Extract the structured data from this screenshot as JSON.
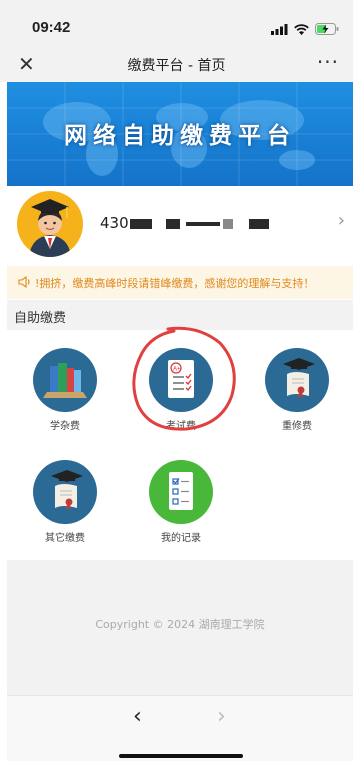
{
  "status_bar": {
    "time": "09:42"
  },
  "nav": {
    "title": "缴费平台 - 首页",
    "close_glyph": "✕",
    "more_glyph": "···"
  },
  "banner": {
    "text": "网络自助缴费平台"
  },
  "user": {
    "id_prefix": "430"
  },
  "notice": {
    "text": "!拥挤，缴费高峰时段请错峰缴费，感谢您的理解与支持！"
  },
  "section": {
    "title": "自助缴费"
  },
  "tiles": [
    {
      "label": "学杂费",
      "icon": "books-icon",
      "color": "#2b6a95"
    },
    {
      "label": "考试费",
      "icon": "exam-paper-icon",
      "color": "#2b6a95"
    },
    {
      "label": "重修费",
      "icon": "diploma-icon",
      "color": "#2b6a95"
    },
    {
      "label": "其它缴费",
      "icon": "diploma-icon",
      "color": "#2b6a95"
    },
    {
      "label": "我的记录",
      "icon": "checklist-icon",
      "color": "#49b73a"
    }
  ],
  "footer": {
    "copyright": "Copyright © 2024   湖南理工学院"
  },
  "bottom_nav": {
    "back_glyph": "‹",
    "forward_glyph": "›"
  }
}
